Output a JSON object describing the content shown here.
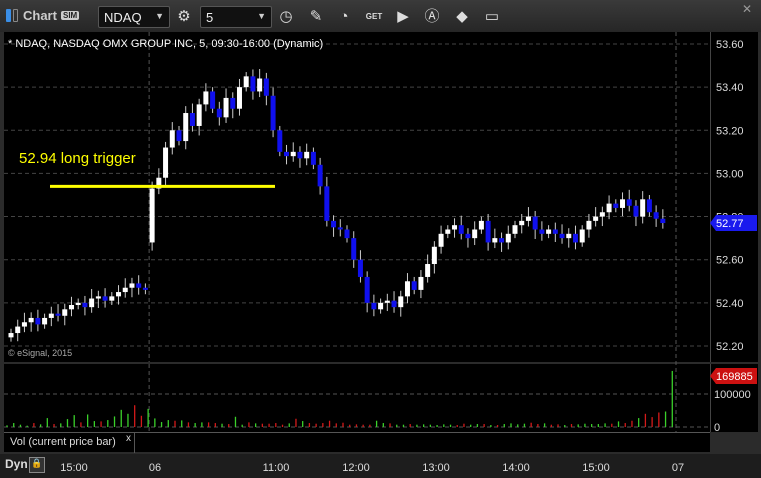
{
  "toolbar": {
    "title": "Chart",
    "sim": "SIM",
    "symbol": "NDAQ",
    "interval": "5",
    "get": "GET",
    "close": "✕"
  },
  "chart": {
    "header": "* NDAQ, NASDAQ OMX GROUP INC, 5, 09:30-16:00 (Dynamic)",
    "copyright": "© eSignal, 2015",
    "annotation": "52.94 long trigger",
    "trigger_price": 52.94,
    "last_price": "52.77",
    "last_value": 52.77,
    "price_ticks": [
      "53.60",
      "53.40",
      "53.20",
      "53.00",
      "52.80",
      "52.60",
      "52.40",
      "52.20"
    ],
    "up_color": "#ffffff",
    "down_color": "#1010ee",
    "line_color": "#ffff00",
    "session_break_index": 21,
    "session_open": 52.68,
    "closes": [
      52.26,
      52.29,
      52.31,
      52.33,
      52.3,
      52.33,
      52.35,
      52.34,
      52.37,
      52.39,
      52.4,
      52.38,
      52.42,
      52.43,
      52.41,
      52.43,
      52.45,
      52.47,
      52.49,
      52.47,
      52.46,
      52.93,
      52.98,
      53.12,
      53.2,
      53.15,
      53.28,
      53.22,
      53.32,
      53.38,
      53.3,
      53.26,
      53.35,
      53.3,
      53.4,
      53.45,
      53.38,
      53.44,
      53.36,
      53.2,
      53.1,
      53.08,
      53.1,
      53.07,
      53.1,
      53.04,
      52.94,
      52.78,
      52.75,
      52.74,
      52.7,
      52.6,
      52.52,
      52.4,
      52.37,
      52.4,
      52.41,
      52.38,
      52.43,
      52.5,
      52.46,
      52.52,
      52.58,
      52.66,
      52.72,
      52.74,
      52.76,
      52.72,
      52.7,
      52.74,
      52.78,
      52.68,
      52.7,
      52.68,
      52.72,
      52.76,
      52.78,
      52.8,
      52.74,
      52.72,
      52.74,
      52.72,
      52.7,
      52.72,
      52.68,
      52.74,
      52.78,
      52.8,
      52.82,
      52.86,
      52.84,
      52.88,
      52.85,
      52.8,
      52.88,
      52.82,
      52.79,
      52.77
    ]
  },
  "volume": {
    "label": "Vol (current price bar)",
    "close": "x",
    "last": "169885",
    "ticks": [
      "100000",
      "0"
    ],
    "values": [
      5000,
      12000,
      7000,
      4000,
      12000,
      8000,
      27000,
      9000,
      11000,
      24000,
      36000,
      14000,
      38000,
      18000,
      17000,
      21000,
      32000,
      52000,
      40000,
      66000,
      34000,
      55000,
      26000,
      15000,
      21000,
      19000,
      20000,
      14000,
      12000,
      14000,
      14000,
      12000,
      10000,
      9000,
      31000,
      7000,
      14000,
      11000,
      10000,
      10000,
      12000,
      7000,
      11000,
      25000,
      18000,
      12000,
      10000,
      12000,
      19000,
      11000,
      13000,
      7000,
      8000,
      7000,
      7000,
      19000,
      12000,
      11000,
      7000,
      7000,
      9000,
      7000,
      8000,
      7000,
      6000,
      8000,
      7000,
      6000,
      10000,
      7000,
      9000,
      9000,
      6000,
      6000,
      9000,
      11000,
      8000,
      10000,
      13000,
      9000,
      11000,
      7000,
      8000,
      6000,
      9000,
      8000,
      10000,
      9000,
      9000,
      11000,
      10000,
      17000,
      12000,
      19000,
      27000,
      40000,
      30000,
      44000,
      47000,
      169885
    ]
  },
  "time_axis": {
    "mode": "Dyn",
    "labels": [
      "15:00",
      "06",
      "11:00",
      "12:00",
      "13:00",
      "14:00",
      "15:00",
      "07"
    ]
  }
}
